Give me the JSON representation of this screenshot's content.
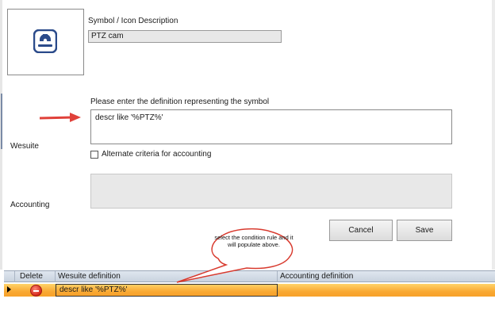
{
  "symbol": {
    "description_label": "Symbol / Icon Description",
    "description_value": "PTZ cam",
    "icon": "ptz-camera-icon"
  },
  "definition": {
    "prompt": "Please enter the definition representing the symbol",
    "value": "descr like '%PTZ%'"
  },
  "sections": {
    "wesuite": "Wesuite",
    "accounting": "Accounting"
  },
  "alternate_criteria": {
    "label": "Alternate criteria for accounting",
    "checked": false
  },
  "accounting_definition": "",
  "buttons": {
    "cancel": "Cancel",
    "save": "Save"
  },
  "grid": {
    "columns": [
      "Delete",
      "Wesuite definition",
      "Accounting definition"
    ],
    "rows": [
      {
        "wesuite": "descr like '%PTZ%'",
        "accounting": "",
        "selected": true
      }
    ]
  },
  "annotation": {
    "callout_text": "select the condition rule and it will populate above."
  },
  "colors": {
    "selected_row": "#f9a933",
    "arrow": "#e0413a",
    "icon_blue": "#2a4a8a"
  }
}
